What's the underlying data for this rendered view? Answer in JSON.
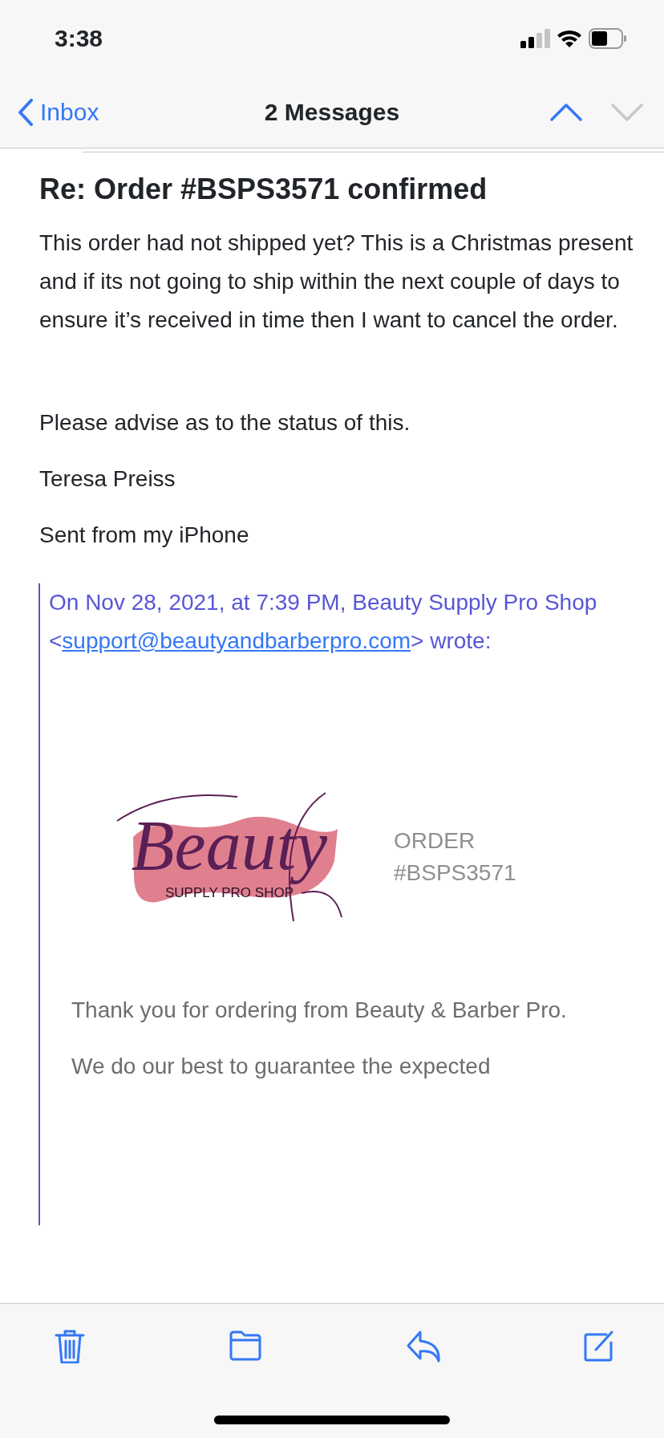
{
  "status_bar": {
    "time": "3:38"
  },
  "nav": {
    "back": "Inbox",
    "title": "2 Messages",
    "up": {
      "disabled": false
    },
    "down": {
      "disabled": true
    }
  },
  "message": {
    "subject": "Re: Order #BSPS3571 confirmed",
    "paragraphs": [
      "This order had not shipped yet?  This is a Christmas present and if its not going to ship within the next couple of days to ensure it’s received in time then I want to cancel the order.",
      "Please advise as to the status of this.",
      "Teresa Preiss",
      "Sent from my iPhone"
    ],
    "quote": {
      "header": "On Nov 28, 2021, at 7:39 PM, Beauty Supply Pro Shop",
      "open": "<",
      "email": "support@beautyandbarberpro.com",
      "close": "> wrote:",
      "logo": {
        "title": "Beauty",
        "subtitle": "SUPPLY PRO SHOP"
      },
      "order_label": "ORDER",
      "order_number": "#BSPS3571",
      "paragraphs": [
        "Thank you for ordering from Beauty & Barber Pro.",
        "We do our best to guarantee the expected"
      ]
    }
  },
  "toolbar": [
    {
      "kind": "trash"
    },
    {
      "kind": "folder"
    },
    {
      "kind": "reply"
    },
    {
      "kind": "compose"
    }
  ]
}
